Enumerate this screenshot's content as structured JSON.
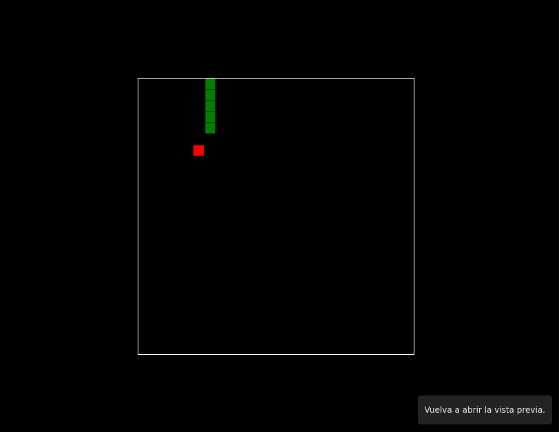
{
  "game": {
    "board_cols": 25,
    "board_rows": 25,
    "board_border_color": "#ffffff",
    "snake_color": "#008000",
    "food_color": "#ff0000",
    "snake_segments": [
      {
        "col": 6,
        "row": 0
      },
      {
        "col": 6,
        "row": 1
      },
      {
        "col": 6,
        "row": 2
      },
      {
        "col": 6,
        "row": 3
      },
      {
        "col": 6,
        "row": 4
      }
    ],
    "food": {
      "col": 5,
      "row": 6
    }
  },
  "toast": {
    "text": "Vuelva a abrir la vista previa."
  }
}
